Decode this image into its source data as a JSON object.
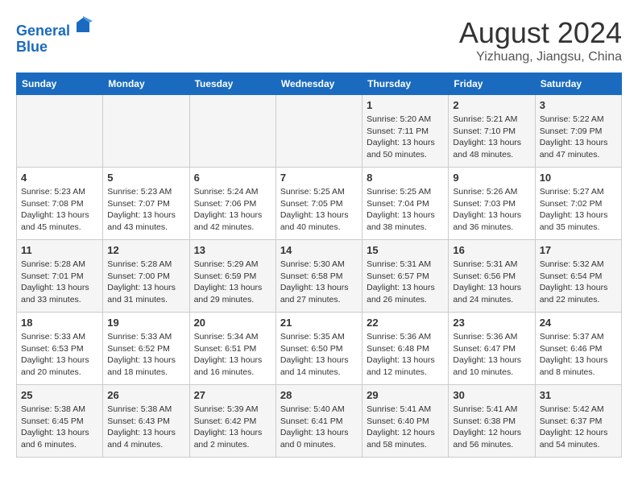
{
  "header": {
    "logo_line1": "General",
    "logo_line2": "Blue",
    "main_title": "August 2024",
    "sub_title": "Yizhuang, Jiangsu, China"
  },
  "weekdays": [
    "Sunday",
    "Monday",
    "Tuesday",
    "Wednesday",
    "Thursday",
    "Friday",
    "Saturday"
  ],
  "weeks": [
    [
      {
        "num": "",
        "info": ""
      },
      {
        "num": "",
        "info": ""
      },
      {
        "num": "",
        "info": ""
      },
      {
        "num": "",
        "info": ""
      },
      {
        "num": "1",
        "info": "Sunrise: 5:20 AM\nSunset: 7:11 PM\nDaylight: 13 hours\nand 50 minutes."
      },
      {
        "num": "2",
        "info": "Sunrise: 5:21 AM\nSunset: 7:10 PM\nDaylight: 13 hours\nand 48 minutes."
      },
      {
        "num": "3",
        "info": "Sunrise: 5:22 AM\nSunset: 7:09 PM\nDaylight: 13 hours\nand 47 minutes."
      }
    ],
    [
      {
        "num": "4",
        "info": "Sunrise: 5:23 AM\nSunset: 7:08 PM\nDaylight: 13 hours\nand 45 minutes."
      },
      {
        "num": "5",
        "info": "Sunrise: 5:23 AM\nSunset: 7:07 PM\nDaylight: 13 hours\nand 43 minutes."
      },
      {
        "num": "6",
        "info": "Sunrise: 5:24 AM\nSunset: 7:06 PM\nDaylight: 13 hours\nand 42 minutes."
      },
      {
        "num": "7",
        "info": "Sunrise: 5:25 AM\nSunset: 7:05 PM\nDaylight: 13 hours\nand 40 minutes."
      },
      {
        "num": "8",
        "info": "Sunrise: 5:25 AM\nSunset: 7:04 PM\nDaylight: 13 hours\nand 38 minutes."
      },
      {
        "num": "9",
        "info": "Sunrise: 5:26 AM\nSunset: 7:03 PM\nDaylight: 13 hours\nand 36 minutes."
      },
      {
        "num": "10",
        "info": "Sunrise: 5:27 AM\nSunset: 7:02 PM\nDaylight: 13 hours\nand 35 minutes."
      }
    ],
    [
      {
        "num": "11",
        "info": "Sunrise: 5:28 AM\nSunset: 7:01 PM\nDaylight: 13 hours\nand 33 minutes."
      },
      {
        "num": "12",
        "info": "Sunrise: 5:28 AM\nSunset: 7:00 PM\nDaylight: 13 hours\nand 31 minutes."
      },
      {
        "num": "13",
        "info": "Sunrise: 5:29 AM\nSunset: 6:59 PM\nDaylight: 13 hours\nand 29 minutes."
      },
      {
        "num": "14",
        "info": "Sunrise: 5:30 AM\nSunset: 6:58 PM\nDaylight: 13 hours\nand 27 minutes."
      },
      {
        "num": "15",
        "info": "Sunrise: 5:31 AM\nSunset: 6:57 PM\nDaylight: 13 hours\nand 26 minutes."
      },
      {
        "num": "16",
        "info": "Sunrise: 5:31 AM\nSunset: 6:56 PM\nDaylight: 13 hours\nand 24 minutes."
      },
      {
        "num": "17",
        "info": "Sunrise: 5:32 AM\nSunset: 6:54 PM\nDaylight: 13 hours\nand 22 minutes."
      }
    ],
    [
      {
        "num": "18",
        "info": "Sunrise: 5:33 AM\nSunset: 6:53 PM\nDaylight: 13 hours\nand 20 minutes."
      },
      {
        "num": "19",
        "info": "Sunrise: 5:33 AM\nSunset: 6:52 PM\nDaylight: 13 hours\nand 18 minutes."
      },
      {
        "num": "20",
        "info": "Sunrise: 5:34 AM\nSunset: 6:51 PM\nDaylight: 13 hours\nand 16 minutes."
      },
      {
        "num": "21",
        "info": "Sunrise: 5:35 AM\nSunset: 6:50 PM\nDaylight: 13 hours\nand 14 minutes."
      },
      {
        "num": "22",
        "info": "Sunrise: 5:36 AM\nSunset: 6:48 PM\nDaylight: 13 hours\nand 12 minutes."
      },
      {
        "num": "23",
        "info": "Sunrise: 5:36 AM\nSunset: 6:47 PM\nDaylight: 13 hours\nand 10 minutes."
      },
      {
        "num": "24",
        "info": "Sunrise: 5:37 AM\nSunset: 6:46 PM\nDaylight: 13 hours\nand 8 minutes."
      }
    ],
    [
      {
        "num": "25",
        "info": "Sunrise: 5:38 AM\nSunset: 6:45 PM\nDaylight: 13 hours\nand 6 minutes."
      },
      {
        "num": "26",
        "info": "Sunrise: 5:38 AM\nSunset: 6:43 PM\nDaylight: 13 hours\nand 4 minutes."
      },
      {
        "num": "27",
        "info": "Sunrise: 5:39 AM\nSunset: 6:42 PM\nDaylight: 13 hours\nand 2 minutes."
      },
      {
        "num": "28",
        "info": "Sunrise: 5:40 AM\nSunset: 6:41 PM\nDaylight: 13 hours\nand 0 minutes."
      },
      {
        "num": "29",
        "info": "Sunrise: 5:41 AM\nSunset: 6:40 PM\nDaylight: 12 hours\nand 58 minutes."
      },
      {
        "num": "30",
        "info": "Sunrise: 5:41 AM\nSunset: 6:38 PM\nDaylight: 12 hours\nand 56 minutes."
      },
      {
        "num": "31",
        "info": "Sunrise: 5:42 AM\nSunset: 6:37 PM\nDaylight: 12 hours\nand 54 minutes."
      }
    ]
  ]
}
